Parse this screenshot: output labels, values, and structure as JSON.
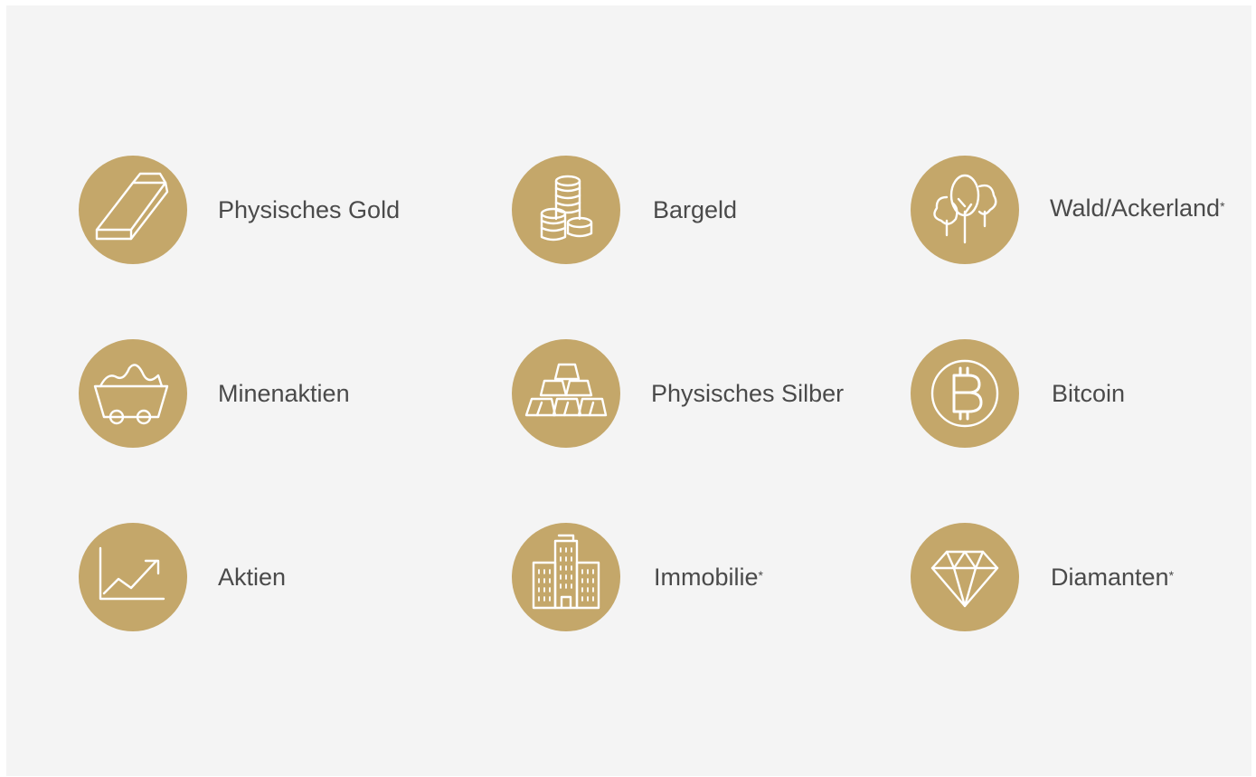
{
  "items": [
    {
      "label": "Physisches Gold",
      "footnote": "",
      "icon": "gold-bar-icon"
    },
    {
      "label": "Bargeld",
      "footnote": "",
      "icon": "coin-stacks-icon"
    },
    {
      "label": "Wald/Ackerland",
      "footnote": "*",
      "icon": "trees-icon"
    },
    {
      "label": "Minenaktien",
      "footnote": "",
      "icon": "mine-cart-icon"
    },
    {
      "label": "Physisches Silber",
      "footnote": "",
      "icon": "silver-bars-icon"
    },
    {
      "label": "Bitcoin",
      "footnote": "",
      "icon": "bitcoin-icon"
    },
    {
      "label": "Aktien",
      "footnote": "",
      "icon": "stock-chart-icon"
    },
    {
      "label": "Immobilie",
      "footnote": "*",
      "icon": "buildings-icon"
    },
    {
      "label": "Diamanten",
      "footnote": "*",
      "icon": "diamond-icon"
    }
  ],
  "colors": {
    "accent": "#c4a76a",
    "background": "#f4f4f4",
    "text": "#4a4a4a",
    "icon_stroke": "#ffffff"
  }
}
